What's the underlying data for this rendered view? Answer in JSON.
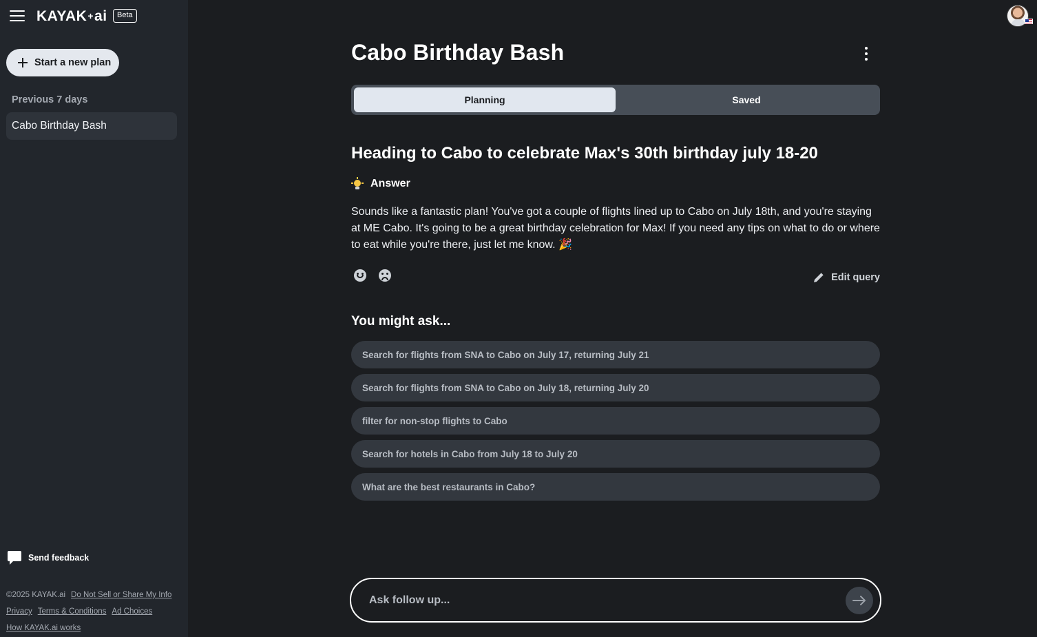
{
  "brand": {
    "logo_left": "KAYAK",
    "logo_plus": "+",
    "logo_right": "ai",
    "badge": "Beta"
  },
  "sidebar": {
    "new_plan_label": "Start a new plan",
    "section_title": "Previous 7 days",
    "items": [
      {
        "label": "Cabo Birthday Bash"
      }
    ],
    "feedback_label": "Send feedback",
    "footer": {
      "copyright": "©2025 KAYAK.ai",
      "links": [
        "Do Not Sell or Share My Info",
        "Privacy",
        "Terms & Conditions",
        "Ad Choices",
        "How KAYAK.ai works"
      ]
    }
  },
  "main": {
    "title": "Cabo Birthday Bash",
    "tabs": [
      {
        "label": "Planning",
        "active": true
      },
      {
        "label": "Saved",
        "active": false
      }
    ],
    "query_heading": "Heading to Cabo to celebrate Max's 30th birthday july 18-20",
    "answer_label": "Answer",
    "answer_text": "Sounds like a fantastic plan! You've got a couple of flights lined up to Cabo on July 18th, and you're staying at ME Cabo. It's going to be a great birthday celebration for Max! If you need any tips on what to do or where to eat while you're there, just let me know.",
    "answer_emoji": "🎉",
    "edit_query_label": "Edit query",
    "might_ask_title": "You might ask...",
    "suggestions": [
      "Search for flights from SNA to Cabo on July 17, returning July 21",
      "Search for flights from SNA to Cabo on July 18, returning July 20",
      "filter for non-stop flights to Cabo",
      "Search for hotels in Cabo from July 18 to July 20",
      "What are the best restaurants in Cabo?"
    ],
    "followup_placeholder": "Ask follow up..."
  },
  "colors": {
    "background": "#1b1d20",
    "sidebar": "#22262c",
    "accent_light": "#e1e7ef",
    "suggestion_bg": "#33383f"
  },
  "icons": [
    "menu-icon",
    "plus-icon",
    "kebab-menu-icon",
    "lightbulb-icon",
    "thumbs-up-face-icon",
    "thumbs-down-face-icon",
    "pencil-icon",
    "chat-bubble-icon",
    "arrow-right-icon",
    "avatar",
    "us-flag-icon"
  ]
}
